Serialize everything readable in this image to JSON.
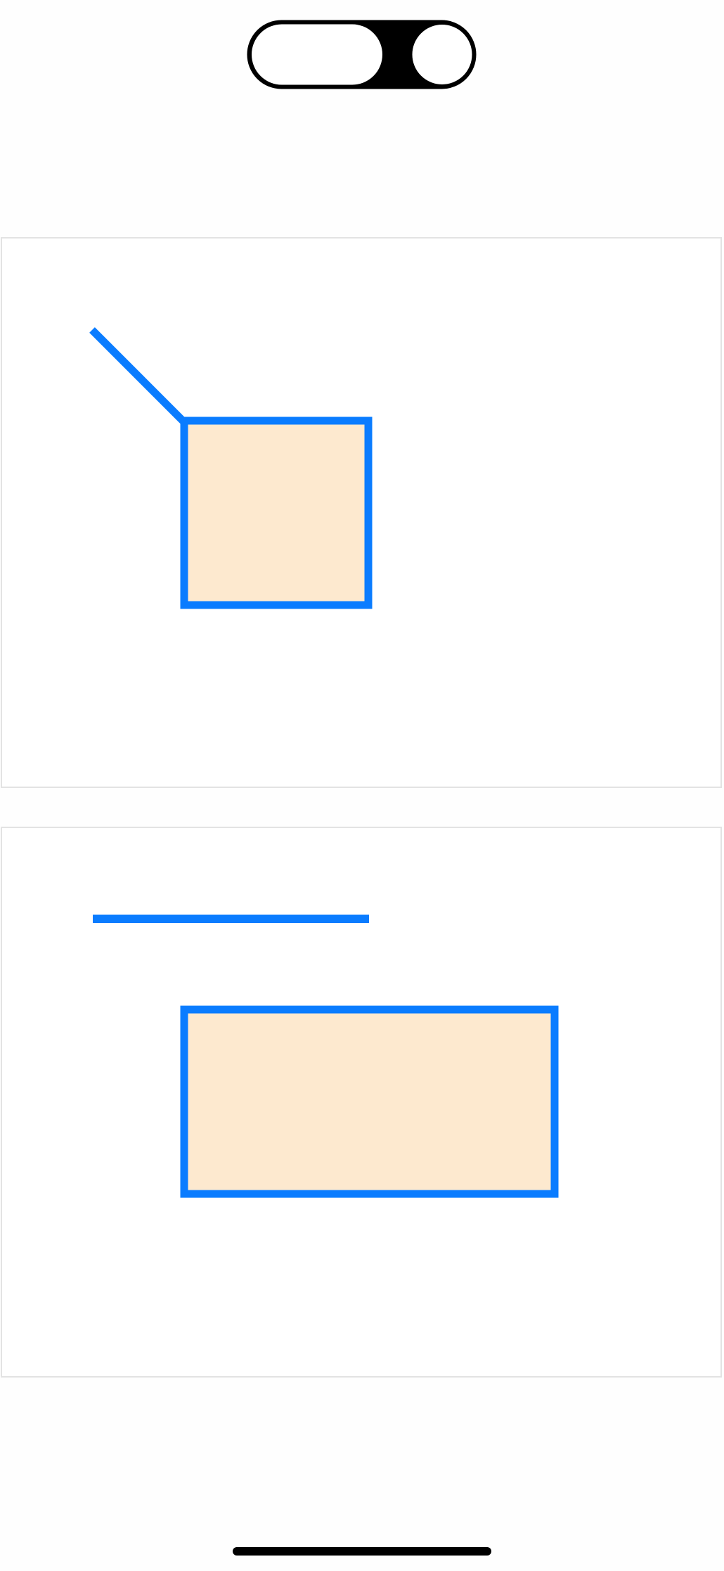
{
  "colors": {
    "background": "#fefefe",
    "panel_border": "#e3e3e3",
    "stroke_accent": "#0a7cff",
    "shape_fill": "#fde9cf",
    "toggle_dark": "#000000",
    "toggle_light": "#ffffff",
    "home_indicator": "#000000"
  },
  "icons": {
    "status_toggle": "toggle-pill-icon",
    "home_indicator": "home-indicator-bar"
  },
  "panels": [
    {
      "id": "panel-top",
      "shapes": [
        "diagonal-line",
        "filled-square"
      ]
    },
    {
      "id": "panel-bottom",
      "shapes": [
        "horizontal-line",
        "filled-rectangle"
      ]
    }
  ]
}
